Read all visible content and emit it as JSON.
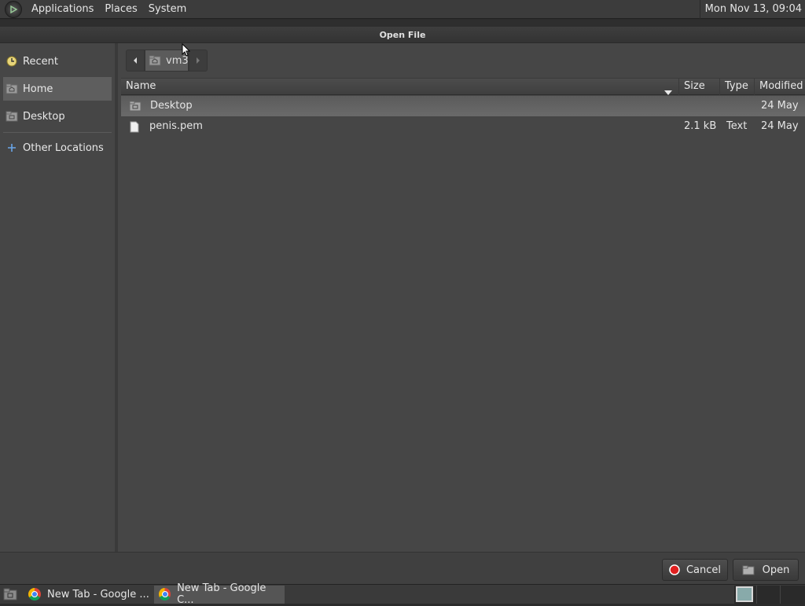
{
  "top_panel": {
    "menus": [
      "Applications",
      "Places",
      "System"
    ],
    "clock": "Mon Nov 13, 09:04"
  },
  "dialog": {
    "title": "Open File",
    "sidebar": {
      "items": [
        {
          "label": "Recent",
          "icon": "recent-icon"
        },
        {
          "label": "Home",
          "icon": "home-folder-icon",
          "active": true
        },
        {
          "label": "Desktop",
          "icon": "desktop-folder-icon"
        },
        {
          "label": "Other Locations",
          "icon": "plus-icon"
        }
      ]
    },
    "pathbar": {
      "current": "vm3"
    },
    "columns": {
      "name": "Name",
      "size": "Size",
      "type": "Type",
      "modified": "Modified"
    },
    "files": [
      {
        "name": "Desktop",
        "size": "",
        "type": "",
        "modified": "24 May",
        "icon": "folder-icon",
        "selected": true
      },
      {
        "name": "penis.pem",
        "size": "2.1 kB",
        "type": "Text",
        "modified": "24 May",
        "icon": "file-icon",
        "selected": false
      }
    ],
    "buttons": {
      "cancel": "Cancel",
      "open": "Open"
    }
  },
  "taskbar": {
    "tasks": [
      {
        "label": "New Tab - Google ...",
        "active": false
      },
      {
        "label": "New Tab - Google C...",
        "active": true
      }
    ]
  }
}
